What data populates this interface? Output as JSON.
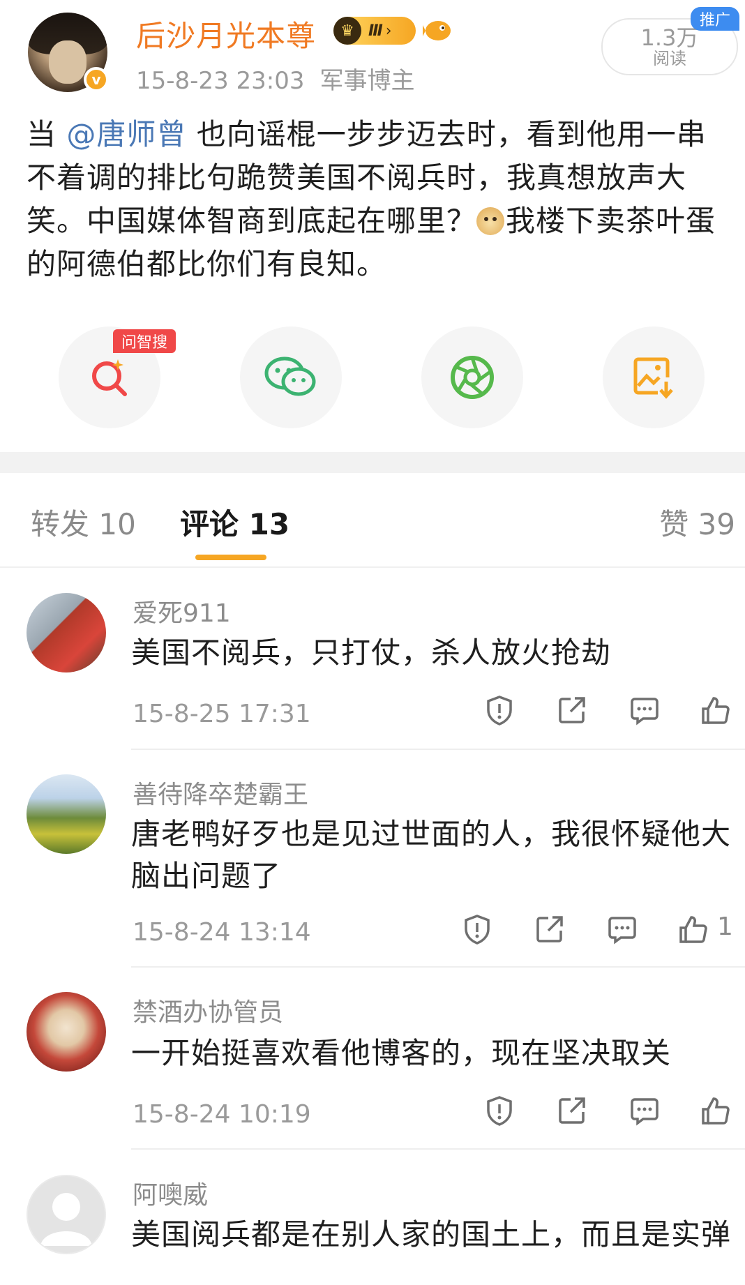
{
  "post": {
    "username": "后沙月光本尊",
    "level_badge": "Ⅲ",
    "timestamp": "15-8-23 23:03",
    "category": "军事博主",
    "read_count": "1.3万",
    "read_label": "阅读",
    "promo_tag": "推广",
    "text_segments": {
      "prefix": "当 ",
      "mention": "@唐师曾",
      "part1": " 也向谣棍一步步迈去时，看到他用一串不着调的排比句跪赞美国不阅兵时，我真想放声大笑。中国媒体智商到底起在哪里？",
      "part2": "我楼下卖茶叶蛋的阿德伯都比你们有良知。"
    },
    "search_tag": "问智搜"
  },
  "tabs": {
    "repost": "转发 10",
    "comment": "评论 13",
    "like": "赞 39"
  },
  "comments": [
    {
      "name": "爱死911",
      "text": "美国不阅兵，只打仗，杀人放火抢劫",
      "time": "15-8-25 17:31",
      "likes": ""
    },
    {
      "name": "善待降卒楚霸王",
      "text": "唐老鸭好歹也是见过世面的人，我很怀疑他大脑出问题了",
      "time": "15-8-24 13:14",
      "likes": "1"
    },
    {
      "name": "禁酒办协管员",
      "text": "一开始挺喜欢看他博客的，现在坚决取关",
      "time": "15-8-24 10:19",
      "likes": ""
    },
    {
      "name": "阿噢威",
      "text": "美国阅兵都是在别人家的国土上，而且是实弹",
      "time": "",
      "likes": ""
    }
  ],
  "colors": {
    "accent_orange": "#f07a23",
    "mention_blue": "#4a78b5",
    "tab_underline": "#f6a623",
    "promo_blue": "#3d8cf0",
    "search_red": "#f04848"
  }
}
